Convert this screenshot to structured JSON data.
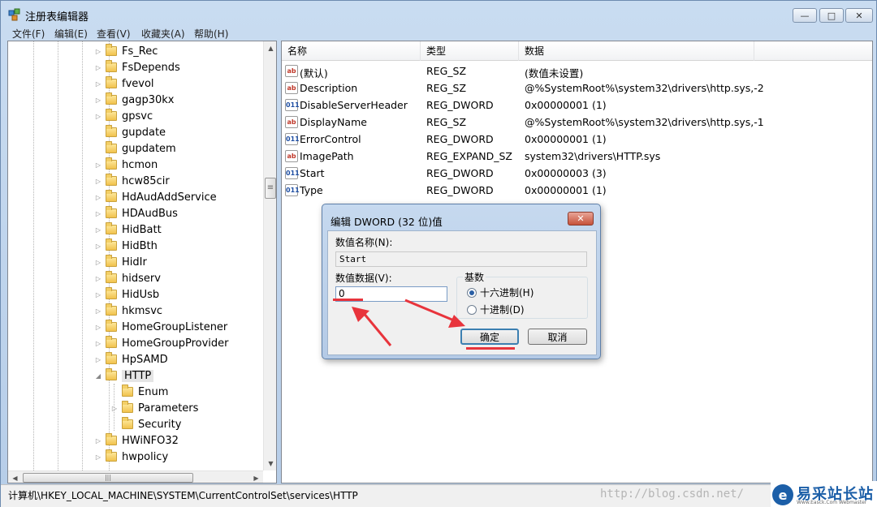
{
  "window": {
    "title": "注册表编辑器",
    "controls": {
      "minimize": "—",
      "maximize": "□",
      "close": "✕"
    }
  },
  "menu": [
    "文件(F)",
    "编辑(E)",
    "查看(V)",
    "收藏夹(A)",
    "帮助(H)"
  ],
  "tree": {
    "items": [
      {
        "label": "Fs_Rec",
        "expander": "▷"
      },
      {
        "label": "FsDepends",
        "expander": "▷"
      },
      {
        "label": "fvevol",
        "expander": "▷"
      },
      {
        "label": "gagp30kx",
        "expander": "▷"
      },
      {
        "label": "gpsvc",
        "expander": "▷"
      },
      {
        "label": "gupdate",
        "expander": ""
      },
      {
        "label": "gupdatem",
        "expander": ""
      },
      {
        "label": "hcmon",
        "expander": "▷"
      },
      {
        "label": "hcw85cir",
        "expander": "▷"
      },
      {
        "label": "HdAudAddService",
        "expander": "▷"
      },
      {
        "label": "HDAudBus",
        "expander": "▷"
      },
      {
        "label": "HidBatt",
        "expander": "▷"
      },
      {
        "label": "HidBth",
        "expander": "▷"
      },
      {
        "label": "HidIr",
        "expander": "▷"
      },
      {
        "label": "hidserv",
        "expander": "▷"
      },
      {
        "label": "HidUsb",
        "expander": "▷"
      },
      {
        "label": "hkmsvc",
        "expander": "▷"
      },
      {
        "label": "HomeGroupListener",
        "expander": "▷"
      },
      {
        "label": "HomeGroupProvider",
        "expander": "▷"
      },
      {
        "label": "HpSAMD",
        "expander": "▷"
      },
      {
        "label": "HTTP",
        "expander": "◢",
        "selected": true
      },
      {
        "label": "Enum",
        "expander": "",
        "child": true
      },
      {
        "label": "Parameters",
        "expander": "▷",
        "child": true
      },
      {
        "label": "Security",
        "expander": "",
        "child": true
      },
      {
        "label": "HWiNFO32",
        "expander": "▷"
      },
      {
        "label": "hwpolicy",
        "expander": "▷"
      }
    ],
    "scroll": {
      "up": "▲",
      "down": "▼",
      "left": "◀",
      "right": "▶",
      "grip": "≡",
      "hgrip": "|||"
    }
  },
  "list": {
    "columns": [
      "名称",
      "类型",
      "数据"
    ],
    "rows": [
      {
        "icon": "ab",
        "name": "(默认)",
        "type": "REG_SZ",
        "data": "(数值未设置)"
      },
      {
        "icon": "ab",
        "name": "Description",
        "type": "REG_SZ",
        "data": "@%SystemRoot%\\system32\\drivers\\http.sys,-2"
      },
      {
        "icon": "011",
        "name": "DisableServerHeader",
        "type": "REG_DWORD",
        "data": "0x00000001 (1)"
      },
      {
        "icon": "ab",
        "name": "DisplayName",
        "type": "REG_SZ",
        "data": "@%SystemRoot%\\system32\\drivers\\http.sys,-1"
      },
      {
        "icon": "011",
        "name": "ErrorControl",
        "type": "REG_DWORD",
        "data": "0x00000001 (1)"
      },
      {
        "icon": "ab",
        "name": "ImagePath",
        "type": "REG_EXPAND_SZ",
        "data": "system32\\drivers\\HTTP.sys"
      },
      {
        "icon": "011",
        "name": "Start",
        "type": "REG_DWORD",
        "data": "0x00000003 (3)"
      },
      {
        "icon": "011",
        "name": "Type",
        "type": "REG_DWORD",
        "data": "0x00000001 (1)"
      }
    ]
  },
  "dialog": {
    "title": "编辑 DWORD (32 位)值",
    "close": "✕",
    "name_label": "数值名称(N):",
    "name_value": "Start",
    "data_label": "数值数据(V):",
    "data_value": "0",
    "base_label": "基数",
    "hex_label": "十六进制(H)",
    "dec_label": "十进制(D)",
    "selected_base": "hex",
    "ok_label": "确定",
    "cancel_label": "取消"
  },
  "status": {
    "path": "计算机\\HKEY_LOCAL_MACHINE\\SYSTEM\\CurrentControlSet\\services\\HTTP",
    "watermark": "http://blog.csdn.net/",
    "brand": "易采站长站",
    "brand_sub": "Www.Easck.Com Webmaster",
    "brand_logo": "e"
  },
  "colors": {
    "annotation": "#e8343c",
    "selection": "#3c7fb1"
  }
}
